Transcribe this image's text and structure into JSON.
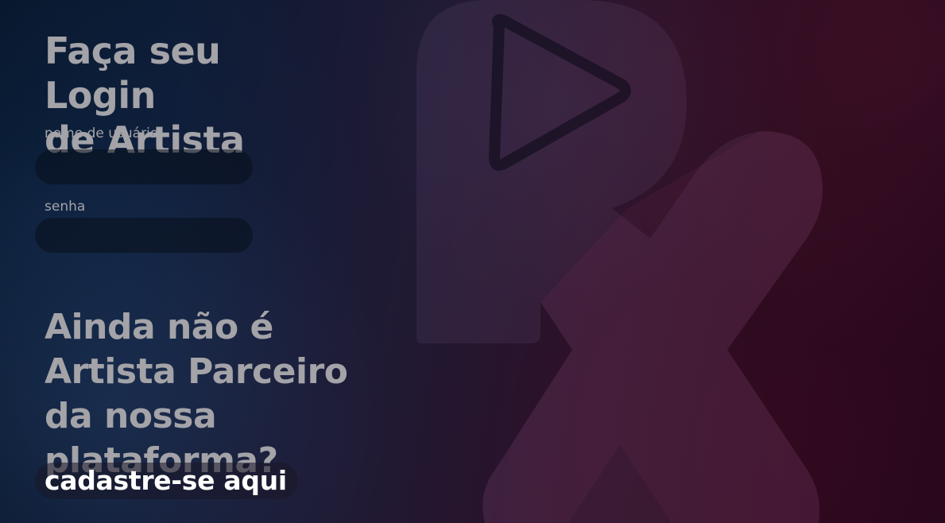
{
  "login": {
    "title_line1": "Faça seu Login",
    "title_line2": "de Artista",
    "username_label": "nome de usuário",
    "username_value": "",
    "password_label": "senha",
    "password_value": ""
  },
  "signup": {
    "question_line1": "Ainda não é",
    "question_line2": "Artista Parceiro",
    "question_line3": "da nossa plataforma?",
    "button_label": "cadastre-se aqui"
  },
  "colors": {
    "text_muted": "#a3a3a8",
    "text_strong": "#ffffff",
    "field_bg": "#0a101c"
  },
  "icons": [
    "brand-logo-icon",
    "play-icon"
  ]
}
